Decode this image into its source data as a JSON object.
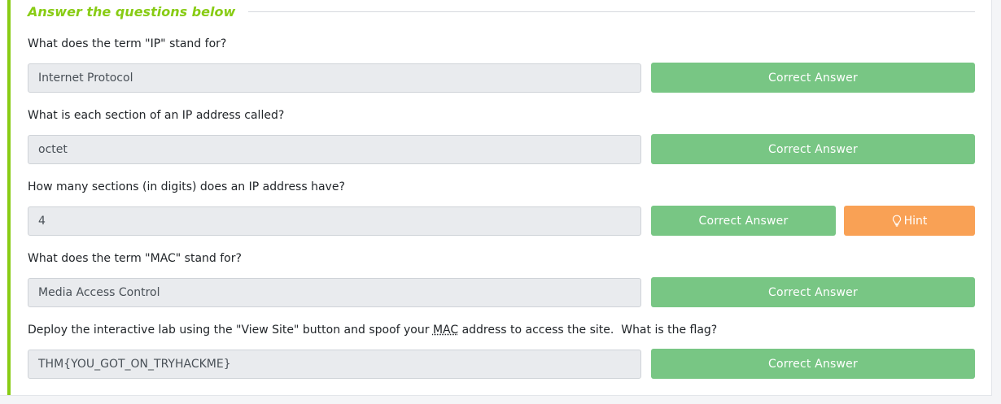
{
  "section": {
    "title": "Answer the questions below"
  },
  "questions": [
    {
      "text": "What does the term \"IP\" stand for?",
      "answer": "Internet Protocol",
      "status": "Correct Answer"
    },
    {
      "text": "What is each section of an IP address called?",
      "answer": "octet",
      "status": "Correct Answer"
    },
    {
      "text": "How many sections (in digits) does an IP address have?",
      "answer": "4",
      "status": "Correct Answer",
      "hint_label": "Hint"
    },
    {
      "text": "What does the term \"MAC\" stand for?",
      "answer": "Media Access Control",
      "status": "Correct Answer"
    },
    {
      "text_before": "Deploy the interactive lab using the \"View Site\" button and spoof your ",
      "text_mac": "MAC",
      "text_after": " address to access the site.  What is the flag?",
      "answer": "THM{YOU_GOT_ON_TRYHACKME}",
      "status": "Correct Answer"
    }
  ],
  "colors": {
    "accent": "#88cc14",
    "correct": "#78c684",
    "hint": "#f9a155",
    "answer_bg": "#e9ebee"
  },
  "icons": {
    "hint": "lightbulb-icon"
  }
}
